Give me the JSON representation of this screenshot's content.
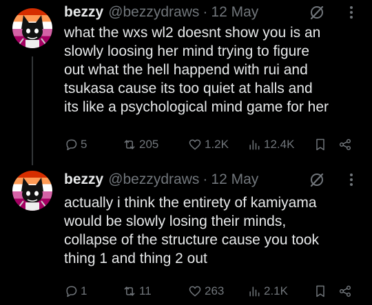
{
  "posts": [
    {
      "display_name": "bezzy",
      "handle": "@bezzydraws",
      "separator": "·",
      "date": "12 May",
      "lines": [
        "what the wxs wl2 doesnt show you is an",
        "slowly loosing her mind trying to figure",
        "out what the hell happend with rui and",
        "tsukasa cause its too quiet at halls and",
        "its like a psychological mind game for her"
      ],
      "replies": "5",
      "reposts": "205",
      "likes": "1.2K",
      "views": "12.4K"
    },
    {
      "display_name": "bezzy",
      "handle": "@bezzydraws",
      "separator": "·",
      "date": "12 May",
      "lines": [
        "actually i think the entirety of kamiyama",
        "would be slowly losing their minds,",
        "collapse of the structure cause you took",
        "thing 1 and thing 2 out"
      ],
      "replies": "1",
      "reposts": "11",
      "likes": "263",
      "views": "2.1K"
    }
  ],
  "icons": {
    "reply": "reply-icon",
    "repost": "repost-icon",
    "like": "heart-icon",
    "views": "views-icon",
    "bookmark": "bookmark-icon",
    "share": "share-icon",
    "grok": "grok-icon",
    "more": "more-icon"
  },
  "colors": {
    "background": "#000000",
    "text": "#e7e9ea",
    "muted": "#71767b"
  }
}
